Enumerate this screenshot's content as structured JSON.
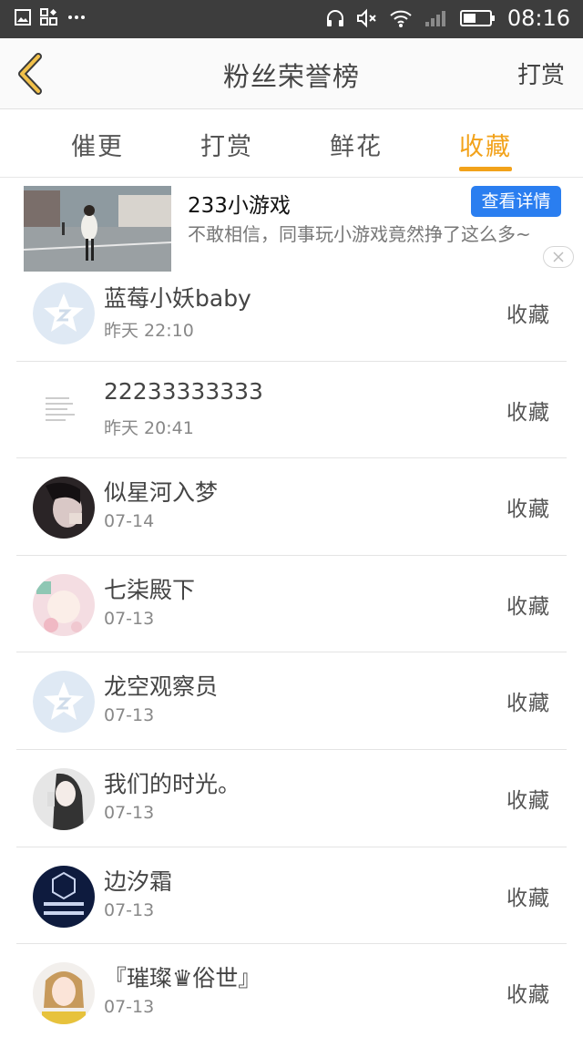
{
  "status_bar": {
    "time": "08:16"
  },
  "header": {
    "title": "粉丝荣誉榜",
    "right_button_label": "打赏"
  },
  "tabs": [
    {
      "label": "催更",
      "active": false
    },
    {
      "label": "打赏",
      "active": false
    },
    {
      "label": "鲜花",
      "active": false
    },
    {
      "label": "收藏",
      "active": true
    }
  ],
  "ad": {
    "title": "233小游戏",
    "cta_label": "查看详情",
    "description": "不敢相信，同事玩小游戏竟然挣了这么多~"
  },
  "list": [
    {
      "name": "蓝莓小妖baby",
      "date": "昨天  22:10",
      "action": "收藏",
      "avatar": "default-star"
    },
    {
      "name": "22233333333",
      "date": "昨天  20:41",
      "action": "收藏",
      "avatar": "document"
    },
    {
      "name": "似星河入梦",
      "date": "07-14",
      "action": "收藏",
      "avatar": "photo-dark"
    },
    {
      "name": "七柒殿下",
      "date": "07-13",
      "action": "收藏",
      "avatar": "photo-pink"
    },
    {
      "name": "龙空观察员",
      "date": "07-13",
      "action": "收藏",
      "avatar": "default-star"
    },
    {
      "name": "我们的时光。",
      "date": "07-13",
      "action": "收藏",
      "avatar": "photo-gray"
    },
    {
      "name": "边汐霜",
      "date": "07-13",
      "action": "收藏",
      "avatar": "exo-logo"
    },
    {
      "name": "『璀璨♛俗世』",
      "date": "07-13",
      "action": "收藏",
      "avatar": "photo-girl"
    }
  ],
  "colors": {
    "accent": "#f2a21a",
    "cta_blue": "#2a7ef0",
    "status_bar": "#3d3d3d"
  }
}
